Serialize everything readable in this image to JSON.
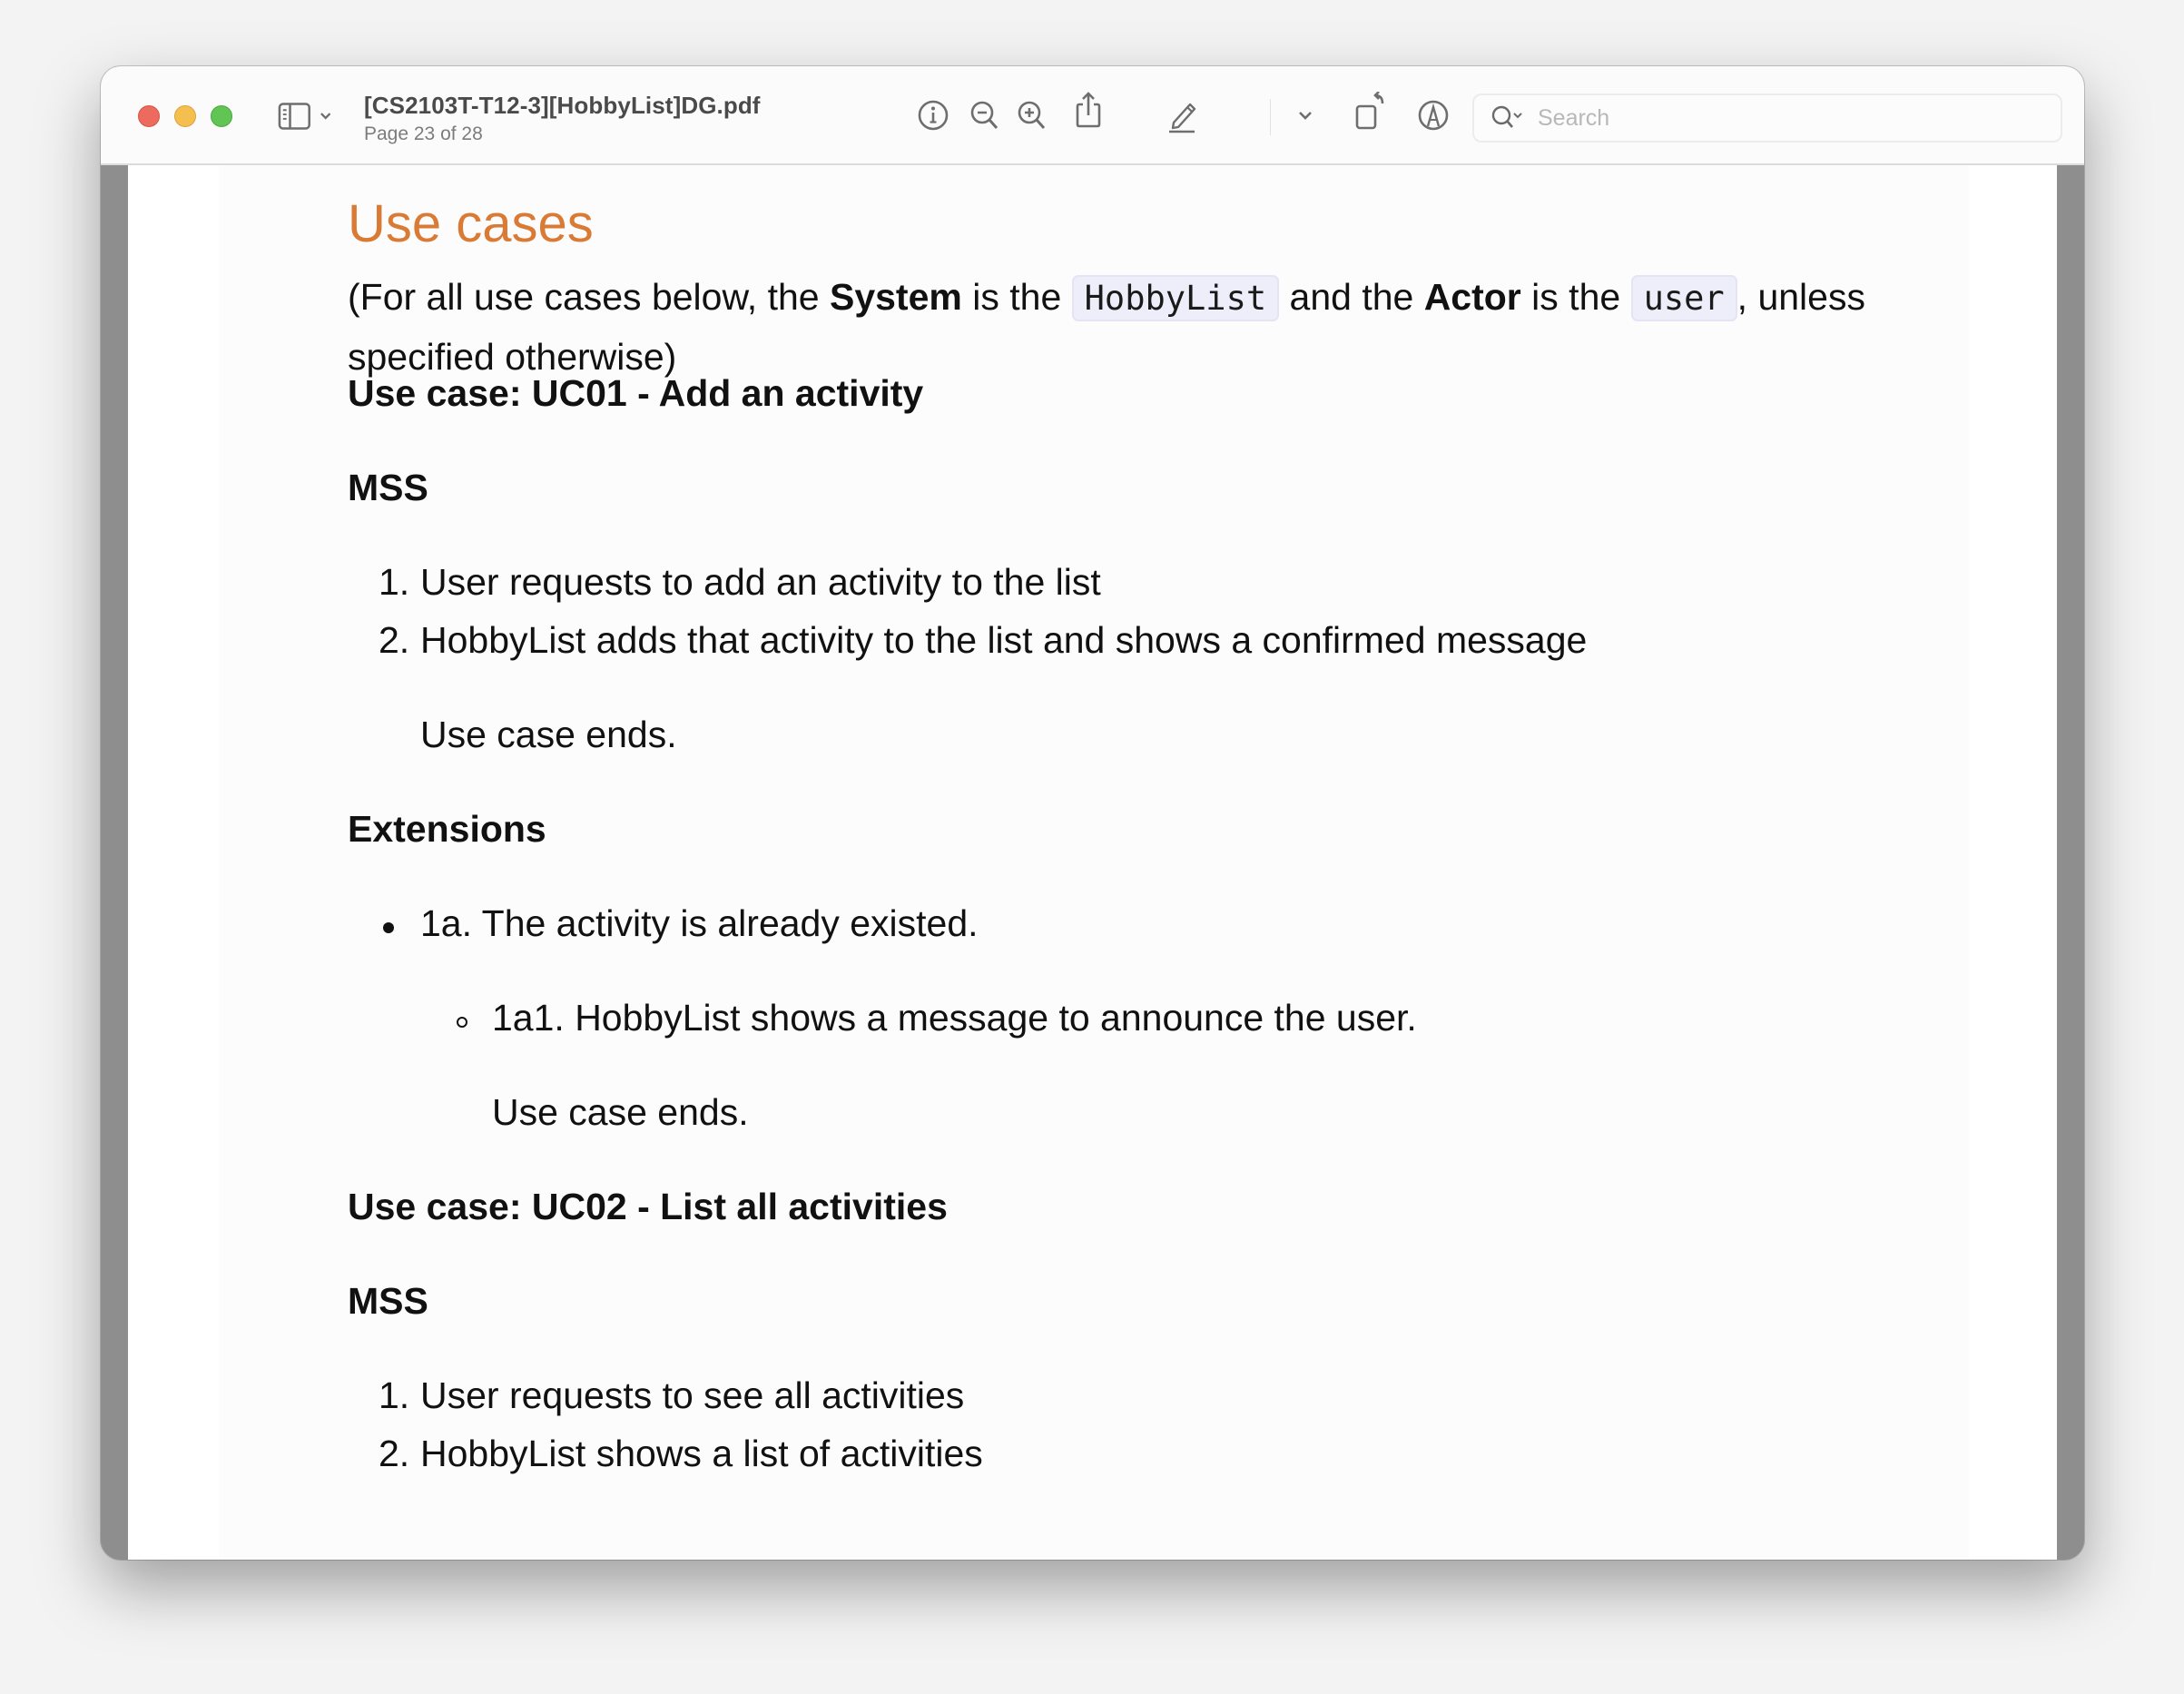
{
  "window": {
    "title": "[CS2103T-T12-3][HobbyList]DG.pdf",
    "subtitle": "Page 23 of 28",
    "controls": [
      "close",
      "minimize",
      "zoom"
    ]
  },
  "toolbar": {
    "icons": [
      "sidebar-toggle-icon",
      "info-icon",
      "zoom-out-icon",
      "zoom-in-icon",
      "share-icon",
      "markup-pencil-icon",
      "markup-dropdown-icon",
      "rotate-icon",
      "annotate-pen-icon"
    ],
    "search_placeholder": "Search",
    "search_value": ""
  },
  "document": {
    "section_title": "Use cases",
    "intro": {
      "part1": "(For all use cases below, the ",
      "system_label": "System",
      "part2": " is the ",
      "system_value": "HobbyList",
      "part3": " and the ",
      "actor_label": "Actor",
      "part4": " is the ",
      "actor_value": "user",
      "part5": ", unless specified otherwise)"
    },
    "use_cases": [
      {
        "title": "Use case: UC01 - Add an activity",
        "mss_label": "MSS",
        "steps": [
          {
            "num": "1.",
            "text": "User requests to add an activity to the list"
          },
          {
            "num": "2.",
            "text": "HobbyList adds that activity to the list and shows a confirmed message"
          }
        ],
        "end_text": "Use case ends.",
        "extensions_label": "Extensions",
        "extensions": [
          {
            "text": "1a. The activity is already existed.",
            "sub": [
              {
                "text": "1a1. HobbyList shows a message to announce the user.",
                "end_text": "Use case ends."
              }
            ]
          }
        ]
      },
      {
        "title": "Use case: UC02 - List all activities",
        "mss_label": "MSS",
        "steps": [
          {
            "num": "1.",
            "text": "User requests to see all activities"
          },
          {
            "num": "2.",
            "text": "HobbyList shows a list of activities"
          }
        ]
      }
    ]
  },
  "colors": {
    "heading_accent": "#d97a35",
    "code_bg": "#eeeefb",
    "close": "#ed6a5e",
    "minimize": "#f5bf4f",
    "zoom": "#61c554"
  }
}
